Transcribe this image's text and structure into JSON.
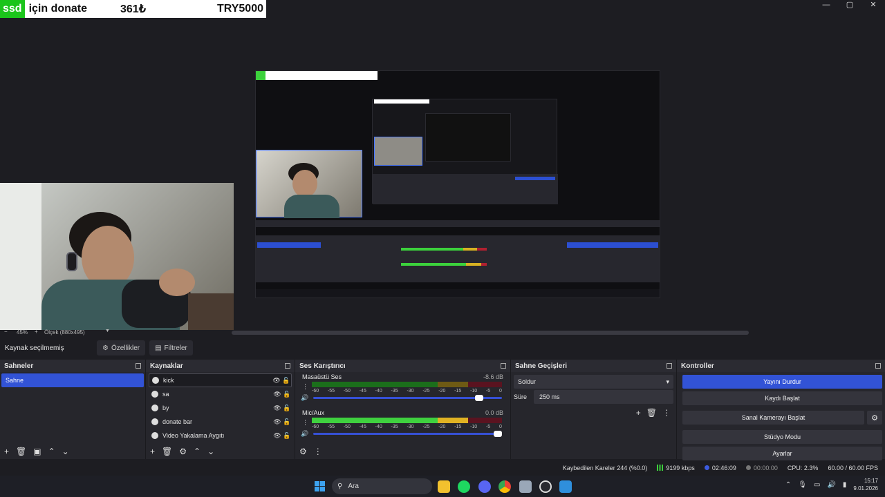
{
  "window": {
    "minimize": "—",
    "maximize": "▢",
    "close": "✕"
  },
  "donate": {
    "tag": "ssd",
    "title": "için donate",
    "amount": "361₺",
    "goal": "TRY5000"
  },
  "preview": {
    "scale_label": "45%",
    "scale_value": "Ölçek (880x495)"
  },
  "source_toolbar": {
    "status": "Kaynak seçilmemiş",
    "properties": "Özellikler",
    "filters": "Filtreler"
  },
  "scenes": {
    "title": "Sahneler",
    "items": [
      "Sahne"
    ]
  },
  "sources": {
    "title": "Kaynaklar",
    "items": [
      {
        "name": "kick"
      },
      {
        "name": "sa"
      },
      {
        "name": "by"
      },
      {
        "name": "donate bar"
      },
      {
        "name": "Video Yakalama Aygıtı"
      }
    ]
  },
  "mixer": {
    "title": "Ses Karıştırıcı",
    "channels": [
      {
        "name": "Masaüstü Ses",
        "db": "-8.6 dB",
        "volume": 0.9
      },
      {
        "name": "Mic/Aux",
        "db": "0.0 dB",
        "volume": 1.0
      }
    ],
    "ticks": [
      "-60",
      "-55",
      "-50",
      "-45",
      "-40",
      "-35",
      "-30",
      "-25",
      "-20",
      "-15",
      "-10",
      "-5",
      "0"
    ]
  },
  "transitions": {
    "title": "Sahne Geçişleri",
    "selected": "Soldur",
    "duration_label": "Süre",
    "duration_value": "250 ms"
  },
  "controls": {
    "title": "Kontroller",
    "stop_stream": "Yayını Durdur",
    "start_record": "Kaydı Başlat",
    "start_virtualcam": "Sanal Kamerayı Başlat",
    "studio_mode": "Stüdyo Modu",
    "settings": "Ayarlar"
  },
  "status": {
    "dropped": "Kaybedilen Kareler 244 (%0.0)",
    "bitrate": "9199 kbps",
    "stream_time": "02:46:09",
    "record_time": "00:00:00",
    "cpu": "CPU: 2.3%",
    "fps": "60.00 / 60.00 FPS"
  },
  "taskbar": {
    "search_placeholder": "Ara",
    "time": "15:17",
    "date": "9.01.2026"
  },
  "colors": {
    "accent": "#3253d6",
    "meter_green": "#3fd13f",
    "meter_yellow": "#e0b223",
    "meter_red": "#b02030"
  }
}
